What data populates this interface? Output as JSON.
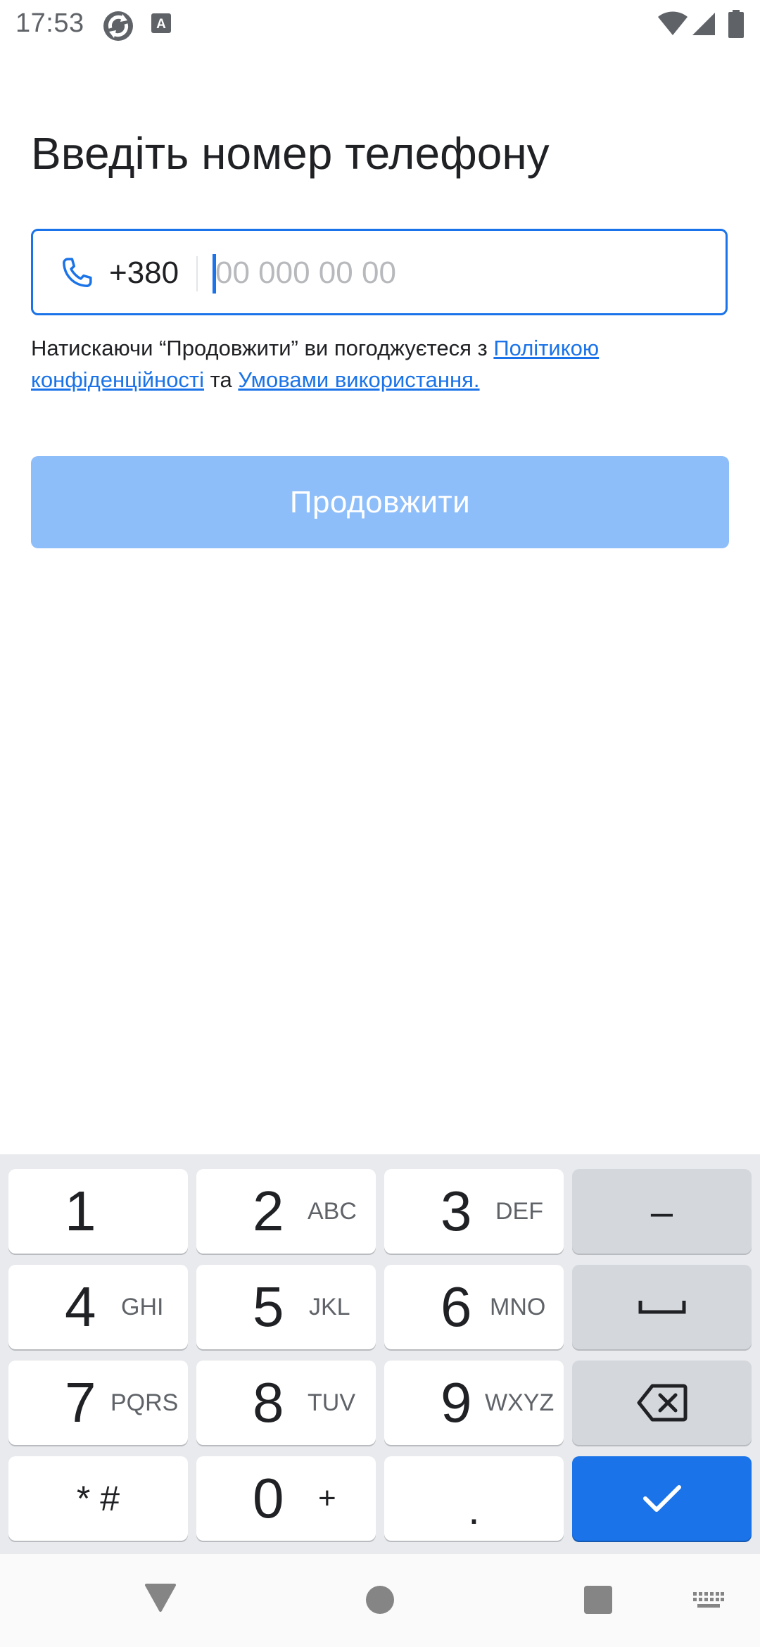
{
  "status_bar": {
    "time": "17:53",
    "icons": [
      "sync-app-icon",
      "keyboard-a-icon",
      "wifi-icon",
      "signal-icon",
      "battery-icon"
    ]
  },
  "page": {
    "title": "Введіть номер телефону"
  },
  "phone_field": {
    "country_code": "+380",
    "value": "",
    "placeholder": "00 000 00 00",
    "icon": "phone-icon"
  },
  "consent": {
    "prefix": "Натискаючи “Продовжити” ви погоджуєтеся з ",
    "privacy_link": "Політикою конфіденційності",
    "middle": " та ",
    "terms_link": "Умовами використання."
  },
  "continue_button": {
    "label": "Продовжити"
  },
  "keyboard": {
    "keys": [
      {
        "digit": "1",
        "letters": ""
      },
      {
        "digit": "2",
        "letters": "ABC"
      },
      {
        "digit": "3",
        "letters": "DEF"
      },
      {
        "digit": "4",
        "letters": "GHI"
      },
      {
        "digit": "5",
        "letters": "JKL"
      },
      {
        "digit": "6",
        "letters": "MNO"
      },
      {
        "digit": "7",
        "letters": "PQRS"
      },
      {
        "digit": "8",
        "letters": "TUV"
      },
      {
        "digit": "9",
        "letters": "WXYZ"
      },
      {
        "digit": "0",
        "letters": "+"
      }
    ],
    "star_hash": "* #",
    "dot": ".",
    "minus": "–"
  },
  "colors": {
    "accent": "#1a73e8",
    "button_disabled": "#8ebefa",
    "keyboard_bg": "#e8eaed",
    "function_key": "#d4d7dc"
  }
}
